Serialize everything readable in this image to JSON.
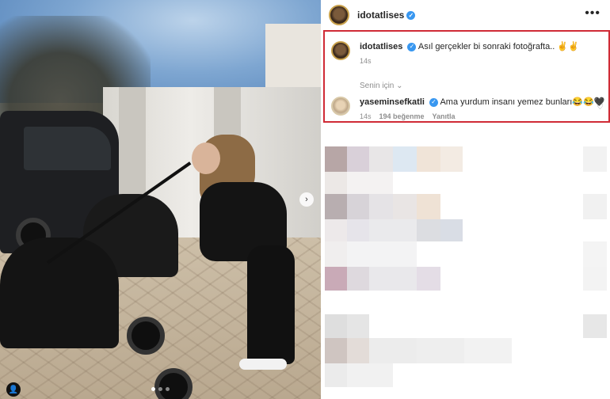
{
  "post": {
    "username": "idotatlises",
    "more_icon": "more-horizontal-icon"
  },
  "caption": {
    "username": "idotatlises",
    "text": "Asıl gerçekler bi sonraki fotoğrafta.. ✌️✌️",
    "time": "14s"
  },
  "filter": {
    "label": "Senin için",
    "chevron": "chevron-down-icon"
  },
  "reply": {
    "username": "yaseminsefkatli",
    "text": "Ama yurdum insanı yemez bunları😂😂🖤",
    "time": "14s",
    "likes": "194 beğenme",
    "reply_label": "Yanıtla"
  },
  "carousel": {
    "next_icon": "chevron-right-icon",
    "dots": 3,
    "active_dot": 1
  },
  "colors": {
    "highlight_border": "#d02b36",
    "verified": "#3897f0"
  }
}
